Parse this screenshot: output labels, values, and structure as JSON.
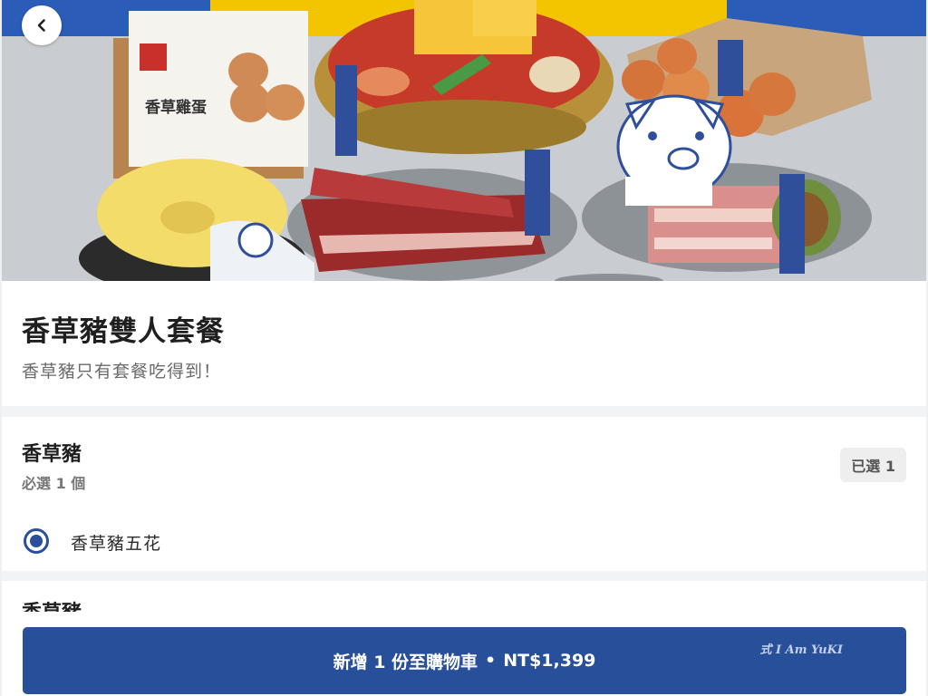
{
  "header": {
    "back_icon": "chevron-left-icon"
  },
  "hero": {
    "egg_box_label": "香草雞蛋"
  },
  "product": {
    "title": "香草豬雙人套餐",
    "subtitle": "香草豬只有套餐吃得到！"
  },
  "option_group": {
    "name": "香草豬",
    "rule": "必選 1 個",
    "selected_badge": "已選 1",
    "options": [
      {
        "label": "香草豬五花",
        "selected": true
      }
    ]
  },
  "next_group": {
    "name": "香草豬"
  },
  "cart": {
    "label": "新增 1 份至購物車",
    "separator": "•",
    "price": "NT$1,399"
  },
  "watermark": "式 I Am YuKI",
  "colors": {
    "primary": "#28509a",
    "radio": "#2b4f9a"
  }
}
